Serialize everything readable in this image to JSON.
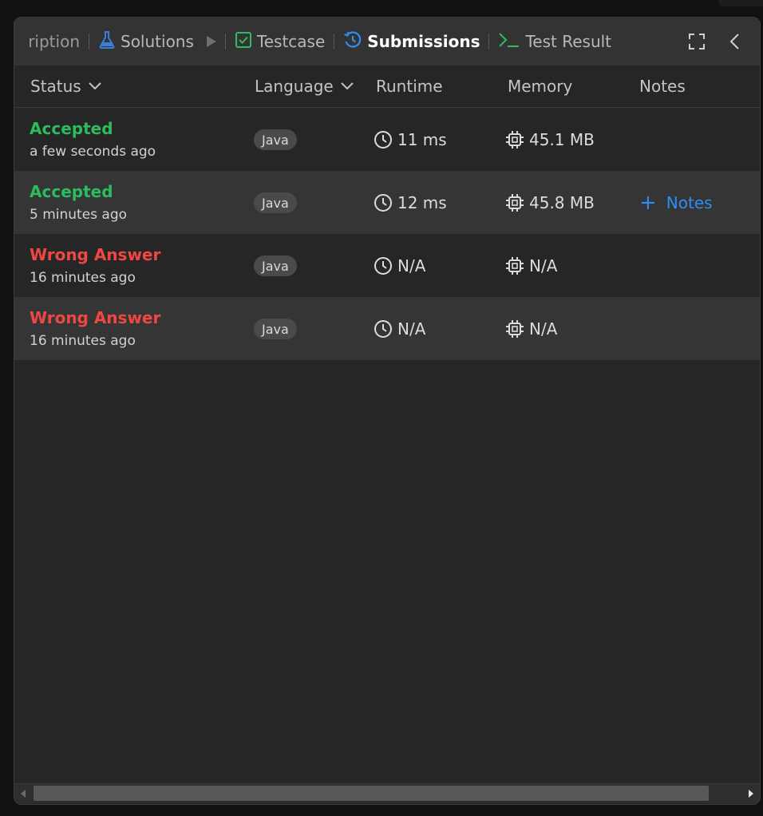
{
  "tabs": [
    {
      "label": "ription",
      "icon": "none"
    },
    {
      "label": "Solutions",
      "icon": "flask-icon"
    },
    {
      "label": "Testcase",
      "icon": "checkbox-icon"
    },
    {
      "label": "Submissions",
      "icon": "history-icon",
      "active": true
    },
    {
      "label": "Test Result",
      "icon": "terminal-icon"
    }
  ],
  "columns": {
    "status": "Status",
    "language": "Language",
    "runtime": "Runtime",
    "memory": "Memory",
    "notes": "Notes"
  },
  "submissions": [
    {
      "status": "Accepted",
      "time": "a few seconds ago",
      "language": "Java",
      "runtime": "11 ms",
      "memory": "45.1 MB",
      "notes": ""
    },
    {
      "status": "Accepted",
      "time": "5 minutes ago",
      "language": "Java",
      "runtime": "12 ms",
      "memory": "45.8 MB",
      "notes": "Notes"
    },
    {
      "status": "Wrong Answer",
      "time": "16 minutes ago",
      "language": "Java",
      "runtime": "N/A",
      "memory": "N/A",
      "notes": ""
    },
    {
      "status": "Wrong Answer",
      "time": "16 minutes ago",
      "language": "Java",
      "runtime": "N/A",
      "memory": "N/A",
      "notes": ""
    }
  ],
  "colors": {
    "accepted": "#2cbb5d",
    "wrong": "#ef4743",
    "link": "#2f8cf3",
    "panel_bg": "#262626",
    "tabbar_bg": "#333333"
  }
}
